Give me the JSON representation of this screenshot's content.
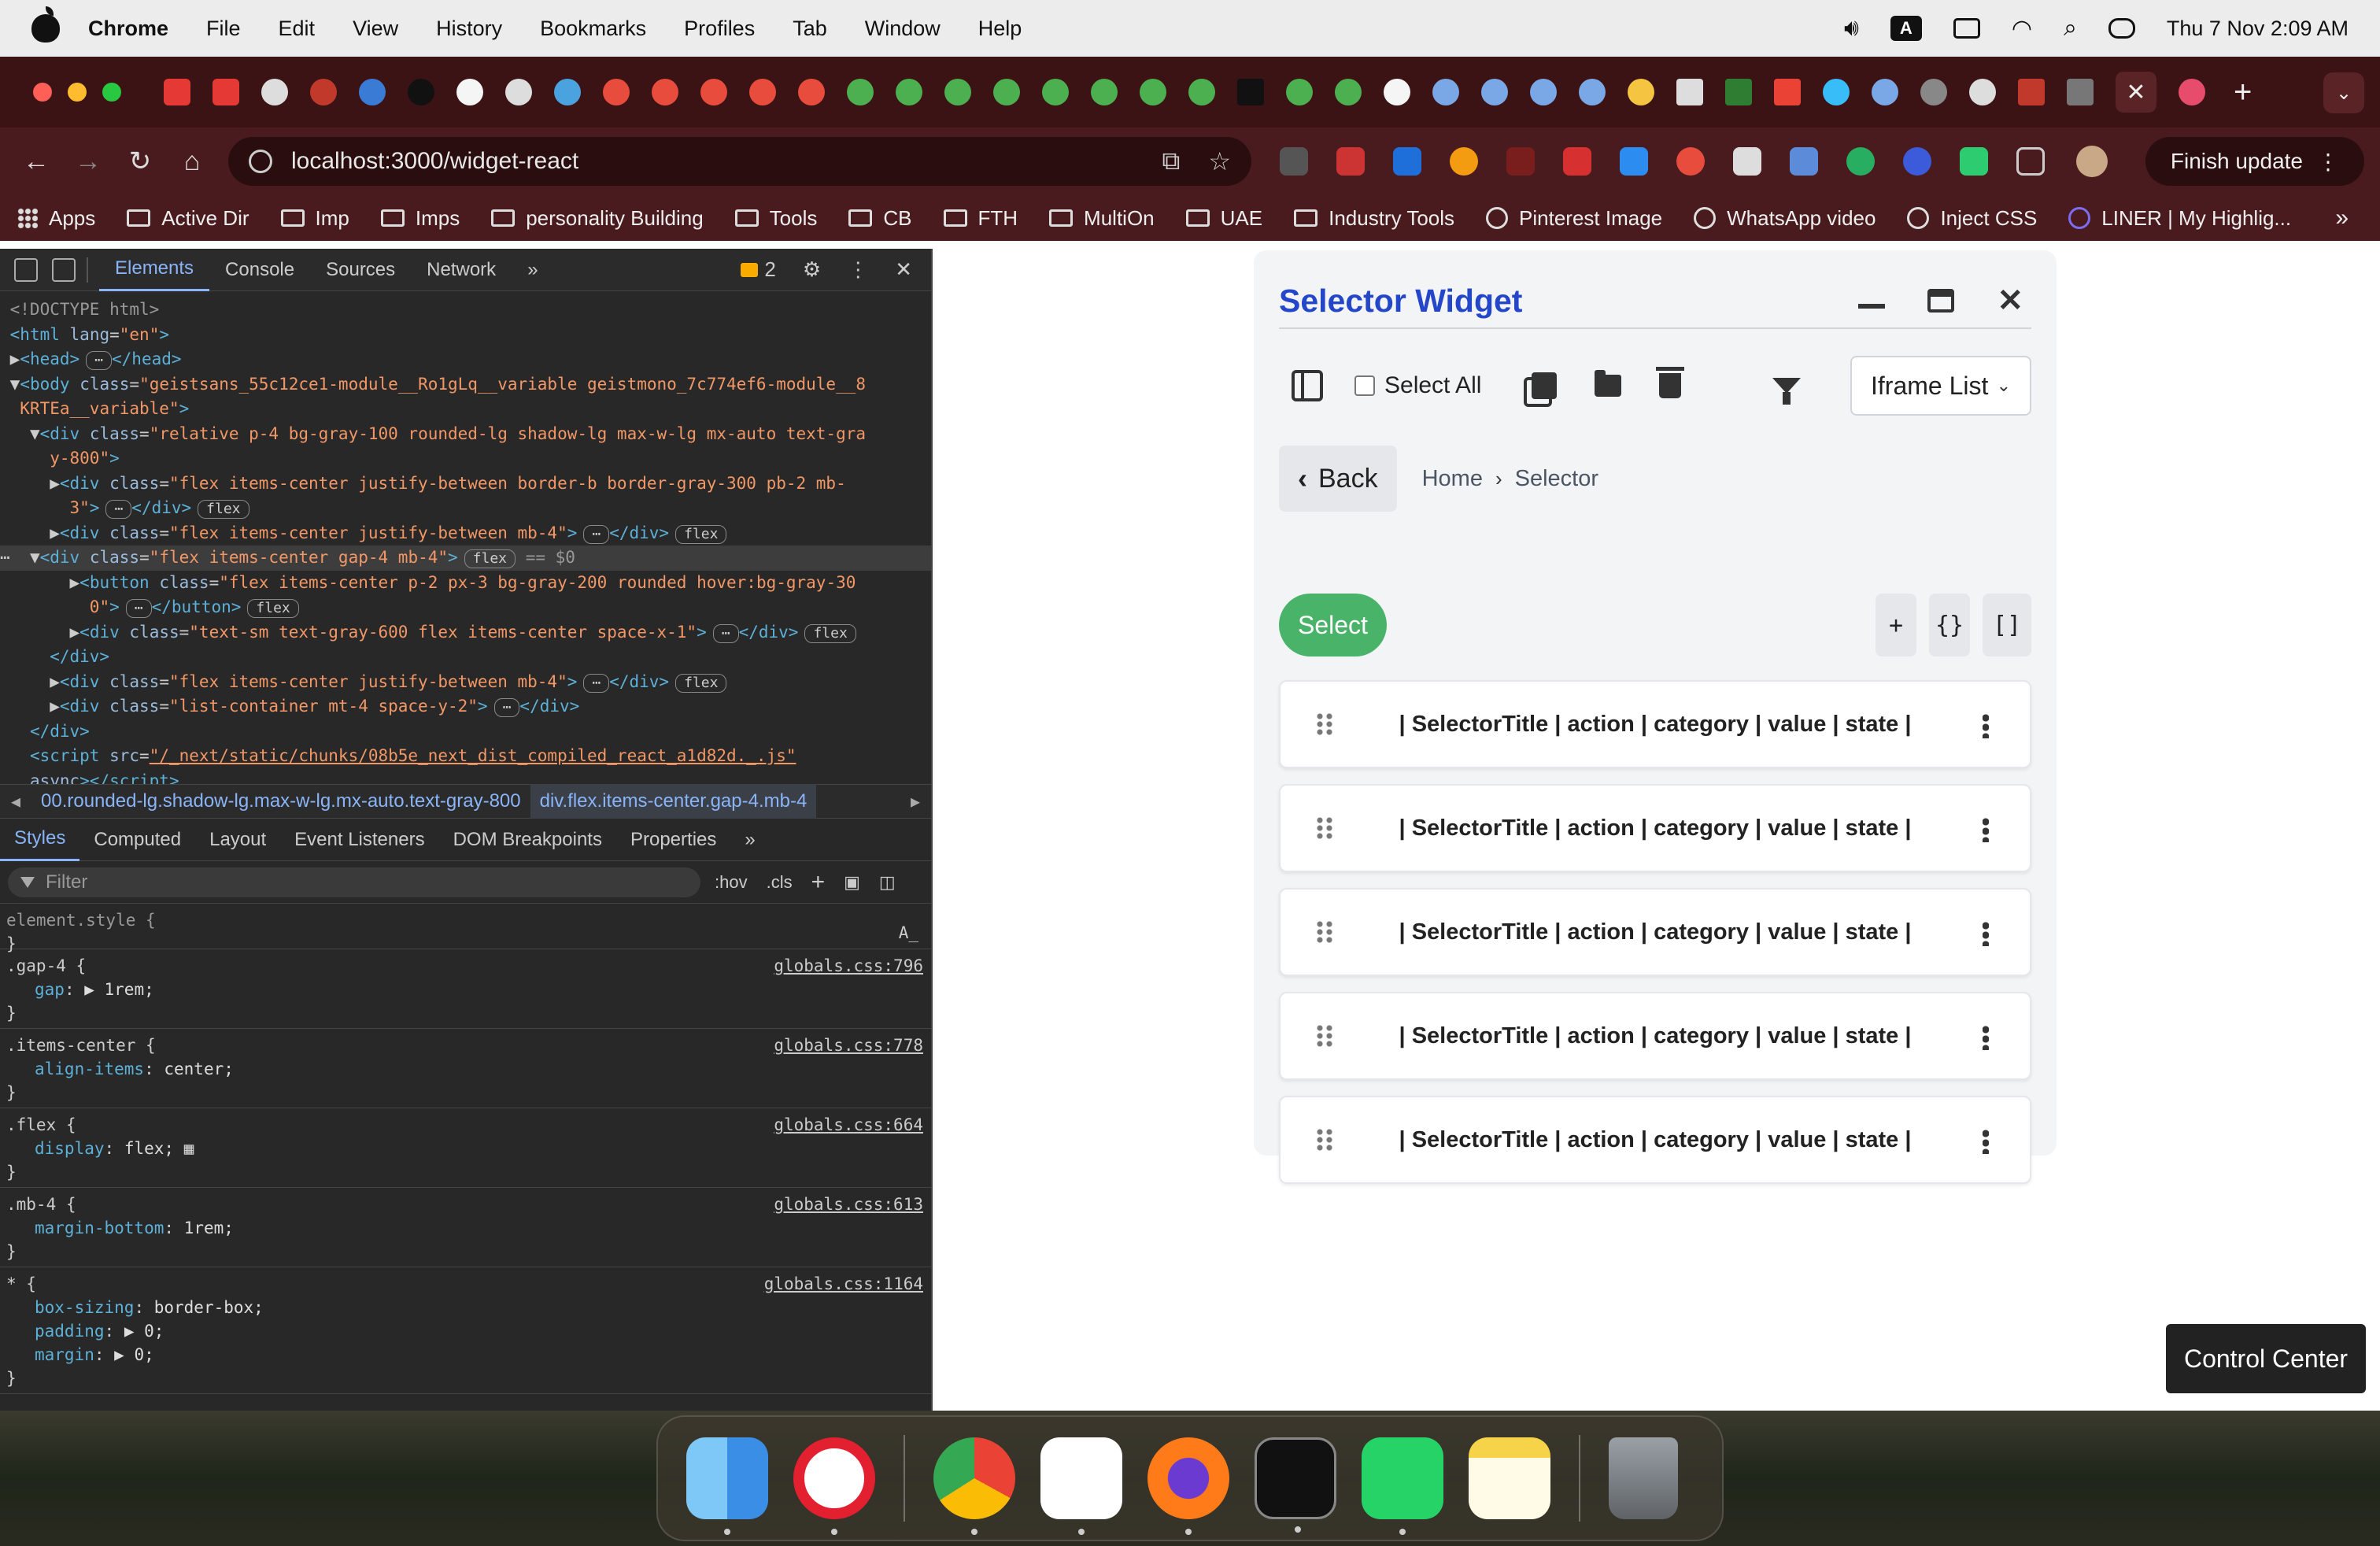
{
  "menubar": {
    "app_name": "Chrome",
    "items": [
      "File",
      "Edit",
      "View",
      "History",
      "Bookmarks",
      "Profiles",
      "Tab",
      "Window",
      "Help"
    ],
    "clock": "Thu 7 Nov  2:09 AM",
    "input_source": "A"
  },
  "browser": {
    "url": "localhost:3000/widget-react",
    "finish_update_label": "Finish update",
    "bookmarks": [
      {
        "label": "Apps",
        "icon": "grid-icon"
      },
      {
        "label": "Active Dir",
        "icon": "folder-icon"
      },
      {
        "label": "Imp",
        "icon": "folder-icon"
      },
      {
        "label": "Imps",
        "icon": "folder-icon"
      },
      {
        "label": "personality Building",
        "icon": "folder-icon"
      },
      {
        "label": "Tools",
        "icon": "folder-icon"
      },
      {
        "label": "CB",
        "icon": "folder-icon"
      },
      {
        "label": "FTH",
        "icon": "folder-icon"
      },
      {
        "label": "MultiOn",
        "icon": "folder-icon"
      },
      {
        "label": "UAE",
        "icon": "folder-icon"
      },
      {
        "label": "Industry Tools",
        "icon": "folder-icon"
      },
      {
        "label": "Pinterest Image",
        "icon": "globe-icon"
      },
      {
        "label": "WhatsApp video",
        "icon": "globe-icon"
      },
      {
        "label": "Inject CSS",
        "icon": "globe-icon"
      },
      {
        "label": "LINER | My Highlig...",
        "icon": "globe-icon"
      }
    ]
  },
  "devtools": {
    "tabs": [
      "Elements",
      "Console",
      "Sources",
      "Network"
    ],
    "active_tab": "Elements",
    "issues_count": "2",
    "breadcrumbs": [
      "00.rounded-lg.shadow-lg.max-w-lg.mx-auto.text-gray-800",
      "div.flex.items-center.gap-4.mb-4"
    ],
    "styles_tabs": [
      "Styles",
      "Computed",
      "Layout",
      "Event Listeners",
      "DOM Breakpoints",
      "Properties"
    ],
    "filter_placeholder": "Filter",
    "hov_label": ":hov",
    "cls_label": ".cls",
    "rules": [
      {
        "selector": "element.style {",
        "source": "",
        "props": [],
        "close": "}"
      },
      {
        "selector": ".gap-4 {",
        "source": "globals.css:796",
        "props": [
          {
            "name": "gap",
            "value": "▶ 1rem;"
          }
        ],
        "close": "}"
      },
      {
        "selector": ".items-center {",
        "source": "globals.css:778",
        "props": [
          {
            "name": "align-items",
            "value": "center;"
          }
        ],
        "close": "}"
      },
      {
        "selector": ".flex {",
        "source": "globals.css:664",
        "props": [
          {
            "name": "display",
            "value": "flex;"
          }
        ],
        "close": "}"
      },
      {
        "selector": ".mb-4 {",
        "source": "globals.css:613",
        "props": [
          {
            "name": "margin-bottom",
            "value": "1rem;"
          }
        ],
        "close": "}"
      },
      {
        "selector": "* {",
        "source": "globals.css:1164",
        "props": [
          {
            "name": "box-sizing",
            "value": "border-box;"
          },
          {
            "name": "padding",
            "value": "▶ 0;"
          },
          {
            "name": "margin",
            "value": "▶ 0;"
          }
        ],
        "close": "}"
      }
    ]
  },
  "widget": {
    "title": "Selector Widget",
    "select_all_label": "Select All",
    "iframe_select_value": "Iframe List",
    "back_label": "Back",
    "breadcrumb": [
      "Home",
      "Selector"
    ],
    "select_button_label": "Select",
    "mini_buttons": [
      "+",
      "{}",
      "[]"
    ],
    "rows": [
      "| SelectorTitle | action | category | value | state |",
      "| SelectorTitle | action | category | value | state |",
      "| SelectorTitle | action | category | value | state |",
      "| SelectorTitle | action | category | value | state |",
      "| SelectorTitle | action | category | value | state |"
    ]
  },
  "control_center_label": "Control Center",
  "dock": [
    "Finder",
    "Opera",
    "Chrome",
    "VS Code",
    "Firefox",
    "Terminal",
    "WhatsApp",
    "Notes",
    "Trash"
  ]
}
